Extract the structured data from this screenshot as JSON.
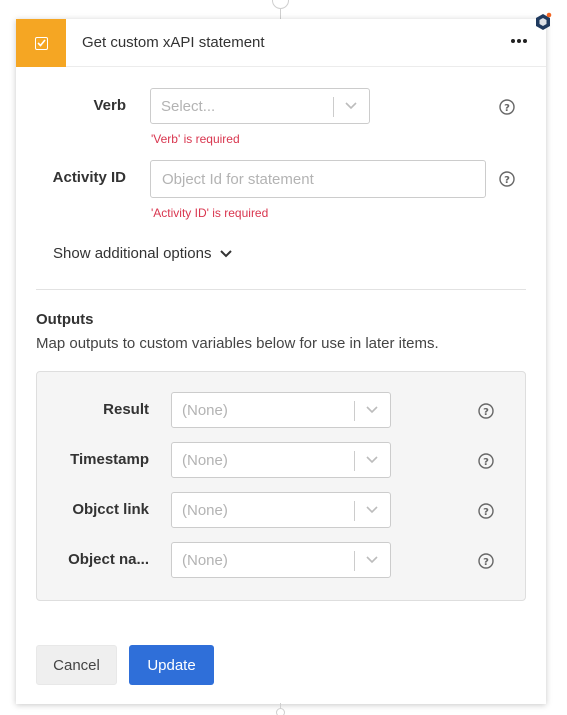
{
  "header": {
    "title": "Get custom xAPI statement"
  },
  "form": {
    "verb": {
      "label": "Verb",
      "placeholder": "Select...",
      "error": "'Verb' is required"
    },
    "activity_id": {
      "label": "Activity ID",
      "placeholder": "Object Id for statement",
      "value": "",
      "error": "'Activity ID' is required"
    },
    "show_additional_options": "Show additional options"
  },
  "outputs": {
    "title": "Outputs",
    "description": "Map outputs to custom variables below for use in later items.",
    "rows": [
      {
        "label": "Result",
        "value": "(None)"
      },
      {
        "label": "Timestamp",
        "value": "(None)"
      },
      {
        "label": "Objcct link",
        "value": "(None)"
      },
      {
        "label": "Object na...",
        "value": "(None)"
      }
    ]
  },
  "footer": {
    "cancel_label": "Cancel",
    "update_label": "Update"
  },
  "colors": {
    "accent": "#f5a623",
    "primary": "#2f6fd9",
    "error": "#d9364f",
    "badge": "#1f3a5f",
    "badge_dot": "#f26522"
  }
}
